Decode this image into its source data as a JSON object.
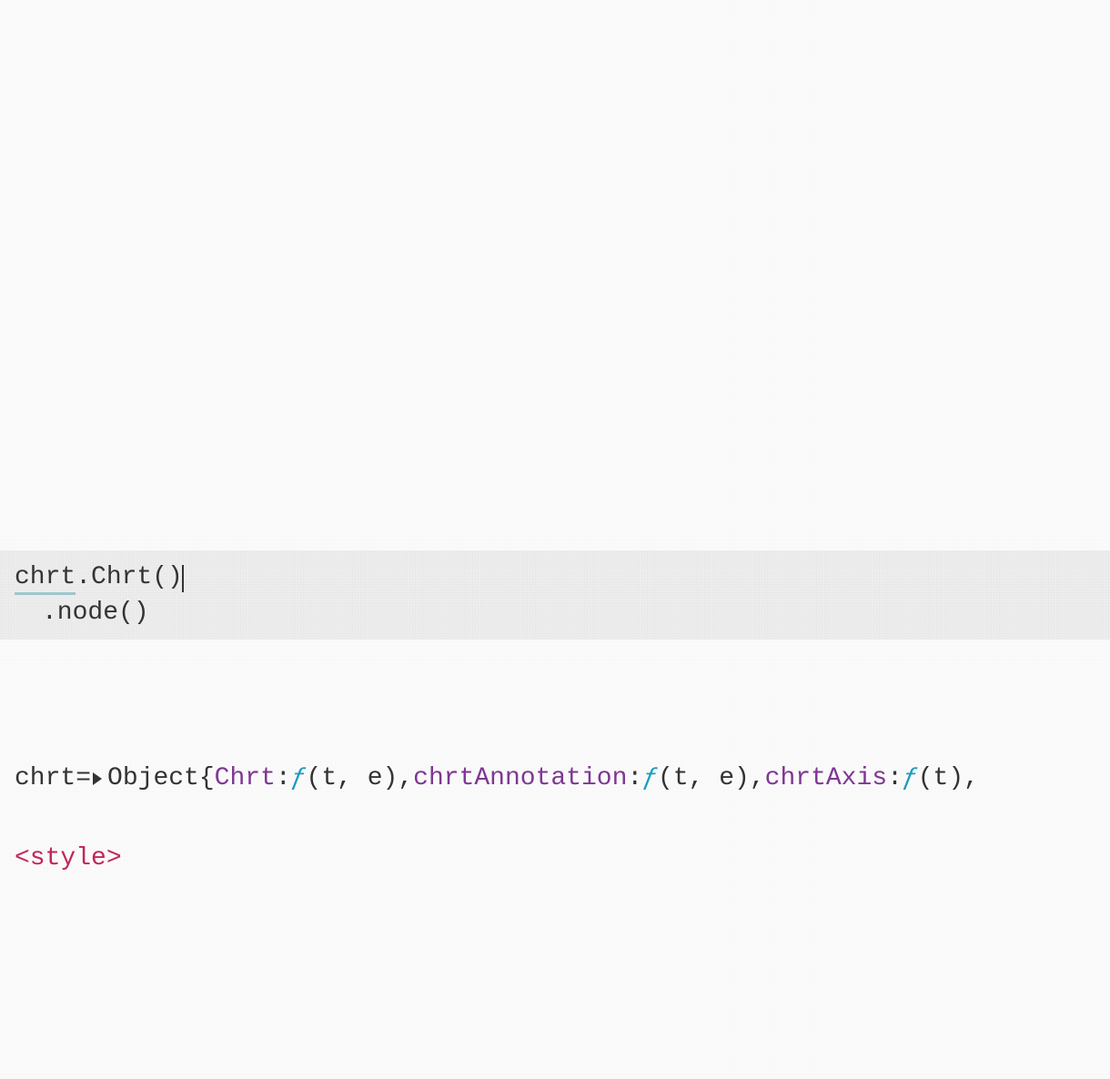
{
  "code_cell": {
    "line1": {
      "part1": "chrt",
      "part2": ".Chrt()"
    },
    "line2": ".node()"
  },
  "result": {
    "var_name": "chrt",
    "equals": " = ",
    "object_label": "Object ",
    "open_brace": "{",
    "entries": [
      {
        "key": "Chrt",
        "fn_sym": "ƒ",
        "args": "(t, e)"
      },
      {
        "key": "chrtAnnotation",
        "fn_sym": "ƒ",
        "args": "(t, e)"
      },
      {
        "key": "chrtAxis",
        "fn_sym": "ƒ",
        "args": "(t)"
      }
    ],
    "colon": ": ",
    "comma": ", ",
    "trailing_comma": ","
  },
  "style_tag": "<style>"
}
